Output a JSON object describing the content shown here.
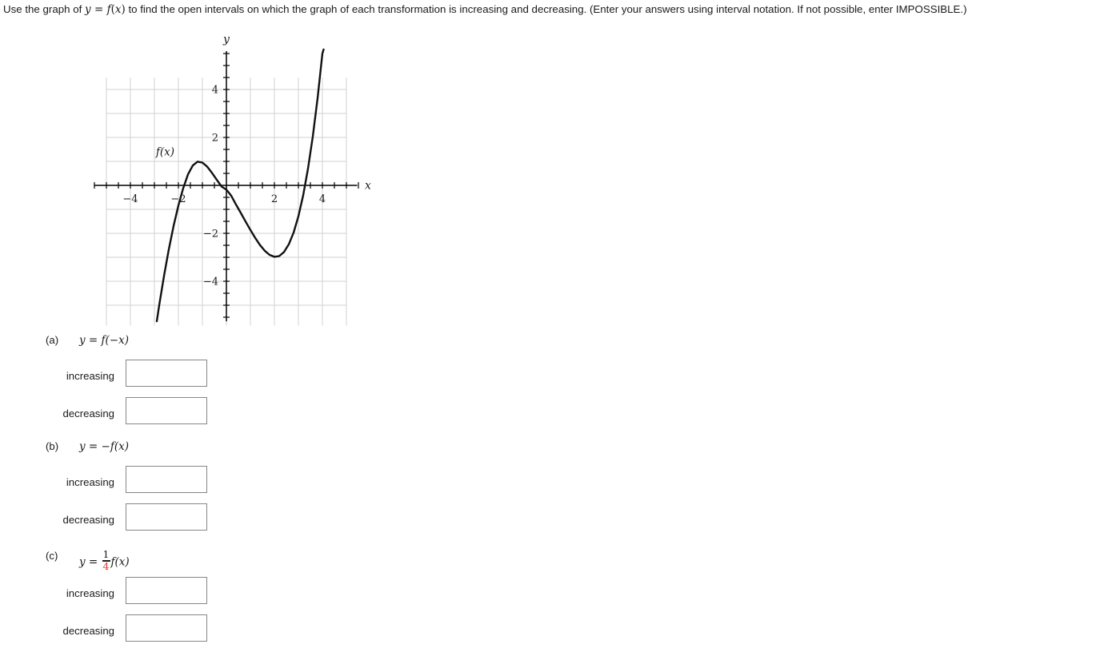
{
  "prompt": {
    "text_before_eq": "Use the graph of ",
    "equation_y": "y",
    "equation_eq": " = ",
    "equation_f": "f",
    "equation_paren_open": "(",
    "equation_x": "x",
    "equation_paren_close": ")",
    "text_after_eq": " to find the open intervals on which the graph of each transformation is increasing and decreasing. (Enter your answers using interval notation. If not possible, enter IMPOSSIBLE.)"
  },
  "figure": {
    "curve_label": "f(x)",
    "x_axis_label": "x",
    "y_axis_label": "y",
    "x_tick_labels": [
      "−4",
      "−2",
      "2",
      "4"
    ],
    "x_tick_values": [
      -4,
      -2,
      2,
      4
    ],
    "y_tick_labels": [
      "4",
      "2",
      "−2",
      "−4"
    ],
    "y_tick_values": [
      4,
      2,
      -2,
      -4
    ]
  },
  "chart_data": {
    "type": "line",
    "title": "",
    "xlabel": "x",
    "ylabel": "y",
    "xlim": [
      -5.5,
      5.55
    ],
    "ylim": [
      -5.67,
      5.67
    ],
    "grid": true,
    "grid_step": 1,
    "minor_tick_step": 0.5,
    "legend": "none",
    "series": [
      {
        "name": "f(x)",
        "label_position": {
          "x": -2.55,
          "y": 1.25
        },
        "description": "cubic polynomial with local maximum near (-1.1, 1.0), root at origin, local minimum near (2.0, -3.0)",
        "local_maximum": {
          "x": -1.1,
          "y": 1.0
        },
        "local_minimum": {
          "x": 2.0,
          "y": -3.0
        },
        "roots": [
          -1.9,
          0.0,
          3.3
        ],
        "points": [
          {
            "x": -2.9,
            "y": -5.67
          },
          {
            "x": -2.8,
            "y": -5.0
          },
          {
            "x": -2.6,
            "y": -3.78
          },
          {
            "x": -2.4,
            "y": -2.67
          },
          {
            "x": -2.2,
            "y": -1.69
          },
          {
            "x": -2.0,
            "y": -0.84
          },
          {
            "x": -1.8,
            "y": -0.12
          },
          {
            "x": -1.6,
            "y": 0.46
          },
          {
            "x": -1.4,
            "y": 0.83
          },
          {
            "x": -1.2,
            "y": 0.99
          },
          {
            "x": -1.0,
            "y": 0.95
          },
          {
            "x": -0.8,
            "y": 0.78
          },
          {
            "x": -0.6,
            "y": 0.52
          },
          {
            "x": -0.4,
            "y": 0.23
          },
          {
            "x": -0.2,
            "y": -0.05
          },
          {
            "x": 0.0,
            "y": -0.18
          },
          {
            "x": 0.2,
            "y": -0.43
          },
          {
            "x": 0.4,
            "y": -0.8
          },
          {
            "x": 0.6,
            "y": -1.15
          },
          {
            "x": 0.8,
            "y": -1.51
          },
          {
            "x": 1.0,
            "y": -1.86
          },
          {
            "x": 1.2,
            "y": -2.19
          },
          {
            "x": 1.4,
            "y": -2.49
          },
          {
            "x": 1.6,
            "y": -2.73
          },
          {
            "x": 1.8,
            "y": -2.9
          },
          {
            "x": 2.0,
            "y": -2.98
          },
          {
            "x": 2.2,
            "y": -2.95
          },
          {
            "x": 2.4,
            "y": -2.78
          },
          {
            "x": 2.6,
            "y": -2.46
          },
          {
            "x": 2.8,
            "y": -1.97
          },
          {
            "x": 3.0,
            "y": -1.29
          },
          {
            "x": 3.2,
            "y": -0.41
          },
          {
            "x": 3.4,
            "y": 0.7
          },
          {
            "x": 3.6,
            "y": 2.04
          },
          {
            "x": 3.8,
            "y": 3.64
          },
          {
            "x": 4.0,
            "y": 5.5
          },
          {
            "x": 4.05,
            "y": 5.67
          }
        ]
      }
    ]
  },
  "parts": [
    {
      "letter": "(a)",
      "eq_y": "y",
      "eq_equals": " = ",
      "eq_body": "f(−x)",
      "increasing_label": "increasing",
      "decreasing_label": "decreasing",
      "increasing_value": "",
      "decreasing_value": "",
      "increasing_placeholder": "",
      "decreasing_placeholder": ""
    },
    {
      "letter": "(b)",
      "eq_y": "y",
      "eq_equals": " = ",
      "eq_body": "−f(x)",
      "increasing_label": "increasing",
      "decreasing_label": "decreasing",
      "increasing_value": "",
      "decreasing_value": "",
      "increasing_placeholder": "",
      "decreasing_placeholder": ""
    },
    {
      "letter": "(c)",
      "eq_y": "y",
      "eq_equals": " = ",
      "eq_frac_num": "1",
      "eq_frac_den": "4",
      "eq_body_after_frac": "f(x)",
      "increasing_label": "increasing",
      "decreasing_label": "decreasing",
      "increasing_value": "",
      "decreasing_value": "",
      "increasing_placeholder": "",
      "decreasing_placeholder": ""
    }
  ],
  "colors": {
    "text": "#1a1a1a",
    "accent_red": "#e8312a",
    "grid": "#d2d2d2",
    "axis": "#000000",
    "curve": "#111111",
    "input_border": "#868686"
  }
}
